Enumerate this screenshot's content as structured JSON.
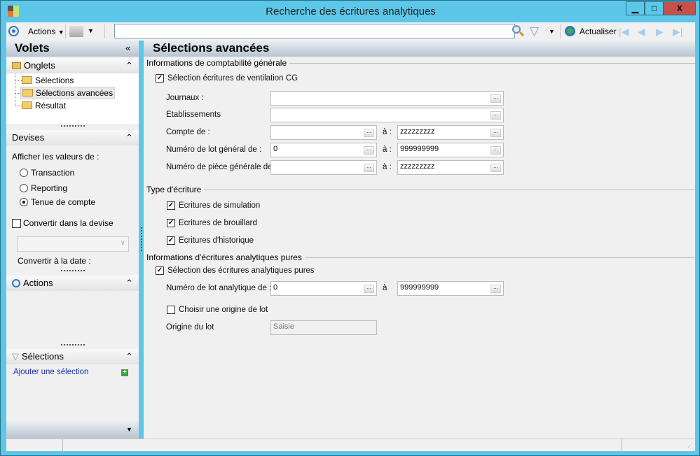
{
  "window": {
    "title": "Recherche des écritures analytiques",
    "minimize": "▁",
    "maximize": "□",
    "close": "X"
  },
  "toolbar": {
    "actions_label": "Actions",
    "refresh_label": "Actualiser",
    "search_value": ""
  },
  "left": {
    "title": "Volets",
    "onglets": {
      "title": "Onglets",
      "items": [
        "Sélections",
        "Sélections avancées",
        "Résultat"
      ]
    },
    "devises": {
      "title": "Devises",
      "show_values_label": "Afficher les valeurs de :",
      "options": [
        "Transaction",
        "Reporting",
        "Tenue de compte"
      ],
      "selected": "Tenue de compte",
      "convert_label": "Convertir dans la devise",
      "convert_checked": false,
      "currency_value": "",
      "convert_date_label": "Convertir à la date :"
    },
    "actions": {
      "title": "Actions"
    },
    "selections": {
      "title": "Sélections",
      "add_link": "Ajouter une sélection"
    }
  },
  "main": {
    "title": "Sélections avancées",
    "general": {
      "title": "Informations de comptabilité générale",
      "ventilation_label": "Sélection écritures de ventilation CG",
      "ventilation_checked": true,
      "journaux_label": "Journaux :",
      "journaux_value": "",
      "etablissements_label": "Etablissements",
      "etablissements_value": "",
      "to_label": "à :",
      "compte_label": "Compte de :",
      "compte_from": "",
      "compte_to": "zzzzzzzzz",
      "lot_label": "Numéro de lot général de :",
      "lot_from": "0",
      "lot_to": "999999999",
      "piece_label": "Numéro de pièce générale de :",
      "piece_from": "",
      "piece_to": "zzzzzzzzz"
    },
    "type": {
      "title": "Type d'écriture",
      "items": [
        "Ecritures de simulation",
        "Ecritures de brouillard",
        "Ecritures d'historique"
      ],
      "checked": [
        true,
        true,
        true
      ]
    },
    "analytic": {
      "title": "Informations d'écritures analytiques pures",
      "select_label": "Sélection des écritures analytiques pures",
      "select_checked": true,
      "lot_label": "Numéro de lot analytique de  :",
      "to_label": "à",
      "lot_from": "0",
      "lot_to": "999999999",
      "origin_choose_label": "Choisir une origine de lot",
      "origin_choose_checked": false,
      "origin_label": "Origine du lot",
      "origin_value": "Saisie"
    }
  },
  "ellipsis": "..."
}
